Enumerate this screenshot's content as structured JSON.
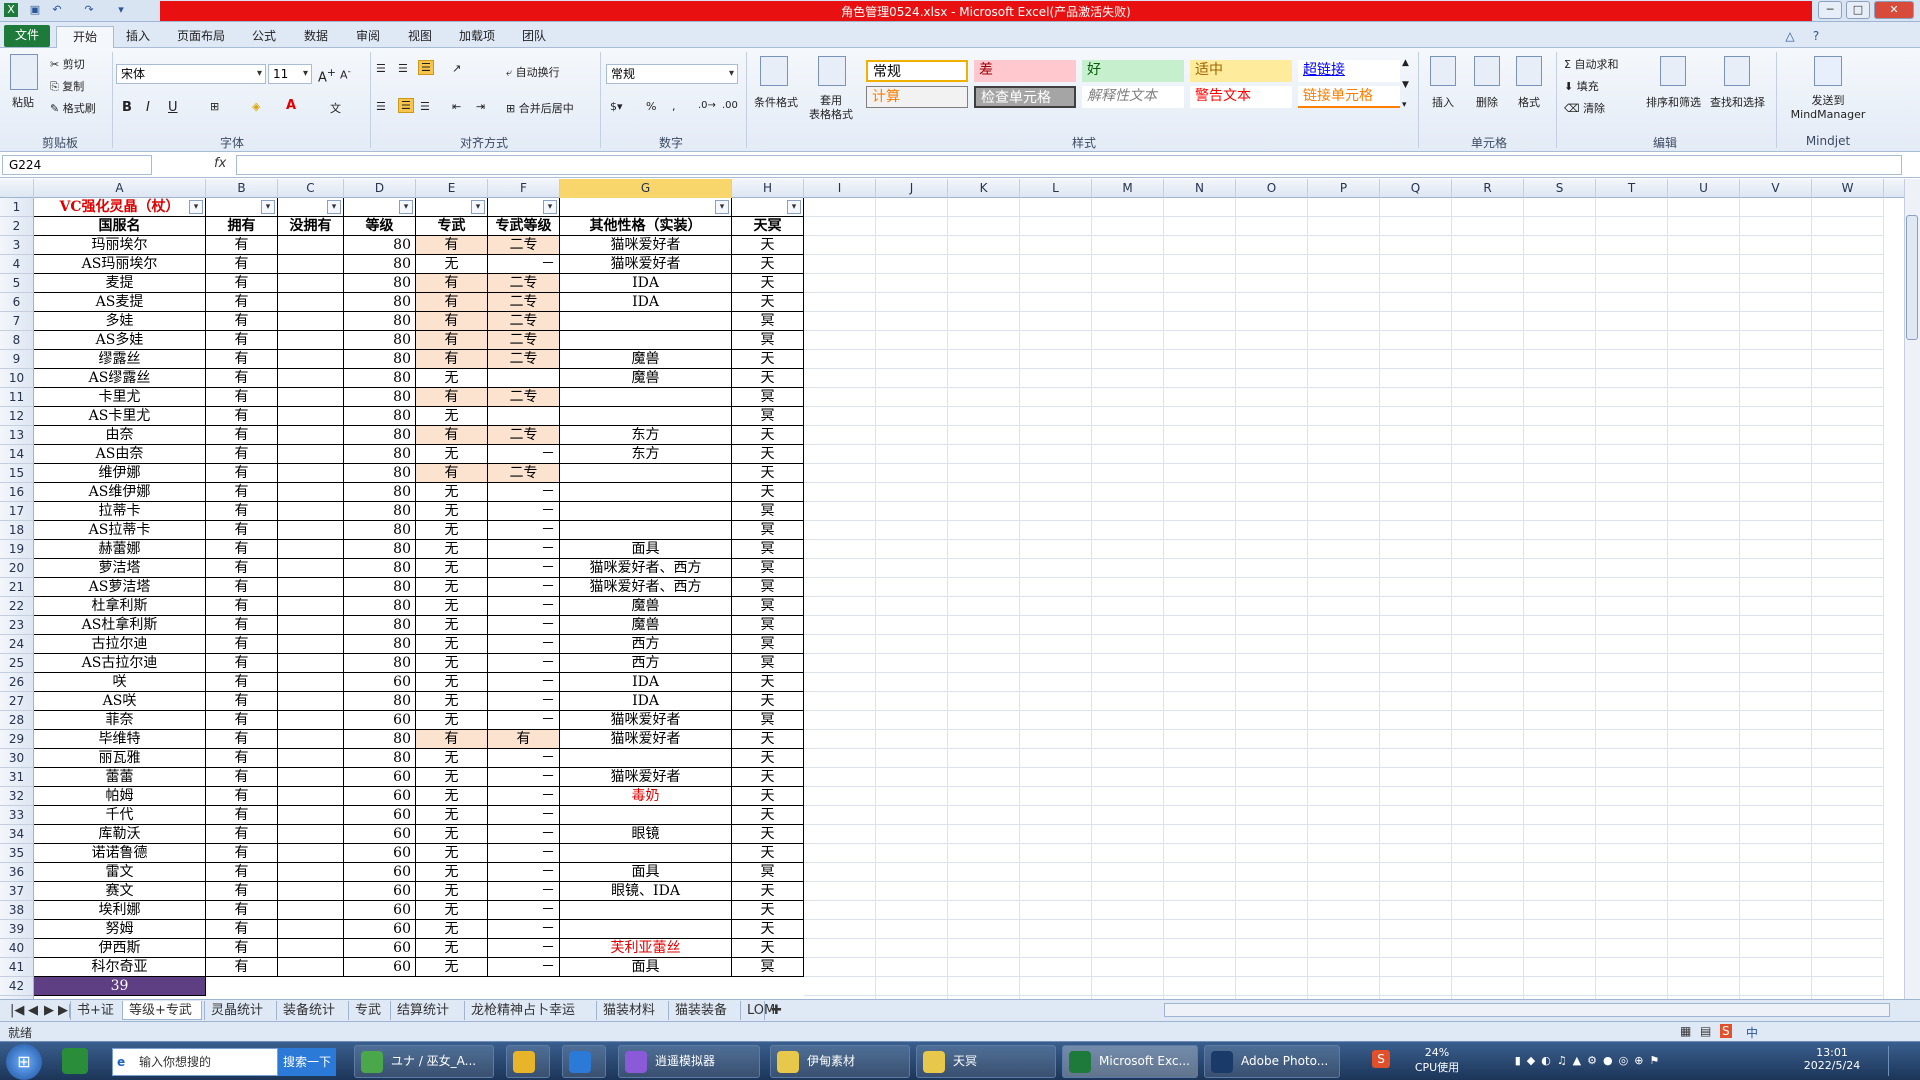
{
  "window": {
    "title": "角色管理0524.xlsx - Microsoft Excel(产品激活失败)",
    "controls": [
      "─",
      "□",
      "✕"
    ]
  },
  "ribbon": {
    "tabs": [
      "文件",
      "开始",
      "插入",
      "页面布局",
      "公式",
      "数据",
      "审阅",
      "视图",
      "加载项",
      "团队"
    ],
    "clipboard": {
      "paste": "粘贴",
      "cut": "剪切",
      "copy": "复制",
      "format_painter": "格式刷",
      "label": "剪贴板"
    },
    "font": {
      "name": "宋体",
      "size": "11",
      "label": "字体"
    },
    "align": {
      "wrap": "自动换行",
      "merge": "合并后居中",
      "label": "对齐方式"
    },
    "number": {
      "format": "常规",
      "label": "数字"
    },
    "styles": {
      "cond_fmt": "条件格式",
      "table_fmt": "套用\n表格格式",
      "cells": [
        {
          "text": "常规",
          "bg": "#ffffff",
          "fg": "#000000"
        },
        {
          "text": "差",
          "bg": "#ffc7ce",
          "fg": "#9c0006"
        },
        {
          "text": "好",
          "bg": "#c6efce",
          "fg": "#006100"
        },
        {
          "text": "适中",
          "bg": "#ffeb9c",
          "fg": "#9c6500"
        },
        {
          "text": "超链接",
          "bg": "#ffffff",
          "fg": "#0000ff"
        },
        {
          "text": "计算",
          "bg": "#f2f2f2",
          "fg": "#fa7d00"
        },
        {
          "text": "检查单元格",
          "bg": "#a5a5a5",
          "fg": "#ffffff"
        },
        {
          "text": "解释性文本",
          "bg": "#ffffff",
          "fg": "#7f7f7f"
        },
        {
          "text": "警告文本",
          "bg": "#ffffff",
          "fg": "#ff0000"
        },
        {
          "text": "链接单元格",
          "bg": "#ffffff",
          "fg": "#fa7d00"
        }
      ],
      "label": "样式"
    },
    "cells_group": {
      "insert": "插入",
      "delete": "删除",
      "format": "格式",
      "label": "单元格"
    },
    "editing": {
      "autosum": "自动求和",
      "fill": "填充",
      "clear": "清除",
      "sort": "排序和筛选",
      "find": "查找和选择",
      "label": "编辑"
    },
    "mindjet": {
      "send": "发送到\nMindManager",
      "label": "Mindjet"
    }
  },
  "formula_bar": {
    "name_box": "G224",
    "fx": "fx",
    "value": ""
  },
  "columns": [
    "A",
    "B",
    "C",
    "D",
    "E",
    "F",
    "G",
    "H",
    "I",
    "J",
    "K",
    "L",
    "M",
    "N",
    "O",
    "P",
    "Q",
    "R",
    "S",
    "T",
    "U",
    "V",
    "W"
  ],
  "selected_column": "G",
  "row1": {
    "a": "VC强化灵晶（杖）"
  },
  "headers": [
    "国服名",
    "拥有",
    "没拥有",
    "等级",
    "专武",
    "专武等级",
    "其他性格（实装）",
    "天冥"
  ],
  "rows": [
    [
      "玛丽埃尔",
      "有",
      "",
      "80",
      "有",
      "二专",
      "猫咪爱好者",
      "天"
    ],
    [
      "AS玛丽埃尔",
      "有",
      "",
      "80",
      "无",
      "－",
      "猫咪爱好者",
      "天"
    ],
    [
      "麦提",
      "有",
      "",
      "80",
      "有",
      "二专",
      "IDA",
      "天"
    ],
    [
      "AS麦提",
      "有",
      "",
      "80",
      "有",
      "二专",
      "IDA",
      "天"
    ],
    [
      "多娃",
      "有",
      "",
      "80",
      "有",
      "二专",
      "",
      "冥"
    ],
    [
      "AS多娃",
      "有",
      "",
      "80",
      "有",
      "二专",
      "",
      "冥"
    ],
    [
      "缪露丝",
      "有",
      "",
      "80",
      "有",
      "二专",
      "魔兽",
      "天"
    ],
    [
      "AS缪露丝",
      "有",
      "",
      "80",
      "无",
      "",
      "魔兽",
      "天"
    ],
    [
      "卡里尤",
      "有",
      "",
      "80",
      "有",
      "二专",
      "",
      "冥"
    ],
    [
      "AS卡里尤",
      "有",
      "",
      "80",
      "无",
      "",
      "",
      "冥"
    ],
    [
      "由奈",
      "有",
      "",
      "80",
      "有",
      "二专",
      "东方",
      "天"
    ],
    [
      "AS由奈",
      "有",
      "",
      "80",
      "无",
      "－",
      "东方",
      "天"
    ],
    [
      "维伊娜",
      "有",
      "",
      "80",
      "有",
      "二专",
      "",
      "天"
    ],
    [
      "AS维伊娜",
      "有",
      "",
      "80",
      "无",
      "－",
      "",
      "天"
    ],
    [
      "拉蒂卡",
      "有",
      "",
      "80",
      "无",
      "－",
      "",
      "冥"
    ],
    [
      "AS拉蒂卡",
      "有",
      "",
      "80",
      "无",
      "－",
      "",
      "冥"
    ],
    [
      "赫蕾娜",
      "有",
      "",
      "80",
      "无",
      "－",
      "面具",
      "冥"
    ],
    [
      "萝洁塔",
      "有",
      "",
      "80",
      "无",
      "－",
      "猫咪爱好者、西方",
      "冥"
    ],
    [
      "AS萝洁塔",
      "有",
      "",
      "80",
      "无",
      "－",
      "猫咪爱好者、西方",
      "冥"
    ],
    [
      "杜拿利斯",
      "有",
      "",
      "80",
      "无",
      "－",
      "魔兽",
      "冥"
    ],
    [
      "AS杜拿利斯",
      "有",
      "",
      "80",
      "无",
      "－",
      "魔兽",
      "冥"
    ],
    [
      "古拉尔迪",
      "有",
      "",
      "80",
      "无",
      "－",
      "西方",
      "冥"
    ],
    [
      "AS古拉尔迪",
      "有",
      "",
      "80",
      "无",
      "－",
      "西方",
      "冥"
    ],
    [
      "咲",
      "有",
      "",
      "60",
      "无",
      "－",
      "IDA",
      "天"
    ],
    [
      "AS咲",
      "有",
      "",
      "80",
      "无",
      "－",
      "IDA",
      "天"
    ],
    [
      "菲奈",
      "有",
      "",
      "60",
      "无",
      "－",
      "猫咪爱好者",
      "冥"
    ],
    [
      "毕维特",
      "有",
      "",
      "80",
      "有",
      "有",
      "猫咪爱好者",
      "天"
    ],
    [
      "丽瓦雅",
      "有",
      "",
      "80",
      "无",
      "－",
      "",
      "天"
    ],
    [
      "蕾蕾",
      "有",
      "",
      "60",
      "无",
      "－",
      "猫咪爱好者",
      "天"
    ],
    [
      "帕姆",
      "有",
      "",
      "60",
      "无",
      "－",
      "毒奶",
      "天"
    ],
    [
      "千代",
      "有",
      "",
      "60",
      "无",
      "－",
      "",
      "天"
    ],
    [
      "库勒沃",
      "有",
      "",
      "60",
      "无",
      "－",
      "眼镜",
      "天"
    ],
    [
      "诺诺鲁德",
      "有",
      "",
      "60",
      "无",
      "－",
      "",
      "天"
    ],
    [
      "雷文",
      "有",
      "",
      "60",
      "无",
      "－",
      "面具",
      "冥"
    ],
    [
      "赛文",
      "有",
      "",
      "60",
      "无",
      "－",
      "眼镜、IDA",
      "天"
    ],
    [
      "埃利娜",
      "有",
      "",
      "60",
      "无",
      "－",
      "",
      "天"
    ],
    [
      "努姆",
      "有",
      "",
      "60",
      "无",
      "－",
      "",
      "天"
    ],
    [
      "伊西斯",
      "有",
      "",
      "60",
      "无",
      "－",
      "芙利亚蕾丝",
      "天"
    ],
    [
      "科尔奇亚",
      "有",
      "",
      "60",
      "无",
      "－",
      "面具",
      "冥"
    ]
  ],
  "red_g_values": [
    "毒奶",
    "芙利亚蕾丝"
  ],
  "count_cell": "39",
  "sheet_tabs": [
    "书+证",
    "等级+专武",
    "灵晶统计",
    "装备统计",
    "专武",
    "结算统计",
    "龙枪精神占卜幸运",
    "猫装材料",
    "猫装装备",
    "LOM"
  ],
  "active_sheet": "等级+专武",
  "status": {
    "ready": "就绪"
  },
  "taskbar": {
    "search_placeholder": "输入你想搜的",
    "search_button": "搜索一下",
    "apps": [
      "ユナ / 巫女_A...",
      "",
      "",
      "逍遥模拟器",
      "伊甸素材",
      "天冥",
      "Microsoft Exc...",
      "Adobe Photo..."
    ],
    "cpu_pct": "24%",
    "cpu_label": "CPU使用",
    "time": "13:01",
    "date": "2022/5/24",
    "ime": "中"
  }
}
